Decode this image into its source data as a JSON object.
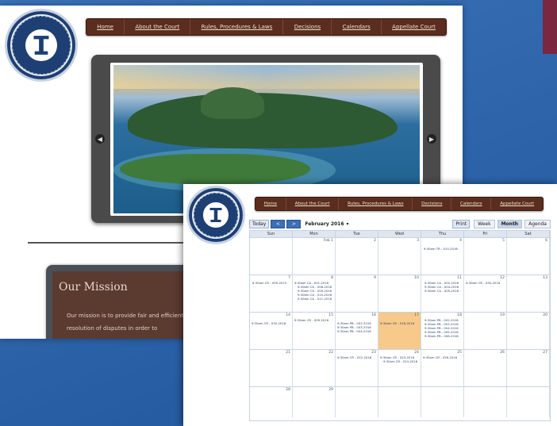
{
  "back": {
    "nav": [
      "Home",
      "About the Court",
      "Rules, Procedures & Laws",
      "Decisions",
      "Calendars",
      "Appellate Court"
    ],
    "mission_title": "Our Mission",
    "mission_text_1": "Our mission is to provide fair and efficient",
    "mission_text_2": "resolution of disputes in order to"
  },
  "front": {
    "nav": [
      "Home",
      "About the Court",
      "Rules, Procedures & Laws",
      "Decisions",
      "Calendars",
      "Appellate Court"
    ],
    "toolbar": {
      "today": "Today",
      "prev": "<",
      "next": ">",
      "month": "February 2016",
      "caret": "▾",
      "print": "Print",
      "week": "Week",
      "month_tab": "Month",
      "agenda": "Agenda"
    },
    "weekdays": [
      "Sun",
      "Mon",
      "Tue",
      "Wed",
      "Thu",
      "Fri",
      "Sat"
    ],
    "weeks": [
      [
        "",
        "Feb 1",
        "2",
        "3",
        "4",
        "5",
        "6"
      ],
      [
        "7",
        "8",
        "9",
        "10",
        "11",
        "12",
        "13"
      ],
      [
        "14",
        "15",
        "16",
        "17",
        "18",
        "19",
        "20"
      ],
      [
        "21",
        "22",
        "23",
        "24",
        "25",
        "26",
        "27"
      ],
      [
        "28",
        "29",
        "",
        "",
        "",
        "",
        ""
      ]
    ],
    "events": {
      "w0_thu": "9:30am TR - 010-2016",
      "w1_mon": "9:30am CR - 059-2015",
      "w1_tue_1": "9:30am CA - 001-2016",
      "w1_tue_2": "9:30am CA - 008-2016",
      "w1_tue_3": "9:30am CA - 009-2016",
      "w1_tue_4": "9:30am CA - 010-2016",
      "w1_tue_5": "9:30am CA - 011-2016",
      "w1_thu_1": "9:30am CA - 002-2016",
      "w1_thu_2": "9:30am CA - 004-2016",
      "w1_thu_3": "9:30am CA - 005-2016",
      "w1_fri": "9:30am CR - 030-2016",
      "w2_sun": "9:30am CR - 030-2016",
      "w2_mon": "9:30am CR - 009-2016",
      "w2_tue_1": "9:30am PB - 002-2016",
      "w2_tue_2": "9:30am PB - 003-2016",
      "w2_tue_3": "9:30am PB - 004-2016",
      "w2_wed": "9:30am CR - 018-2016",
      "w2_thu_1": "9:30am PB - 002-2016",
      "w2_thu_2": "9:30am PB - 003-2016",
      "w2_thu_3": "9:30am PB - 004-2016",
      "w2_thu_4": "9:30am PB - 005-2016",
      "w2_thu_5": "9:30am PB - 006-2016",
      "w3_tue": "9:30am CR - 022-2016",
      "w3_wed_1": "9:30am CR - 023-2016",
      "w3_wed_2": "9:30am CR - 024-2016",
      "w3_thu": "9:30am CR - 026-2016"
    }
  }
}
